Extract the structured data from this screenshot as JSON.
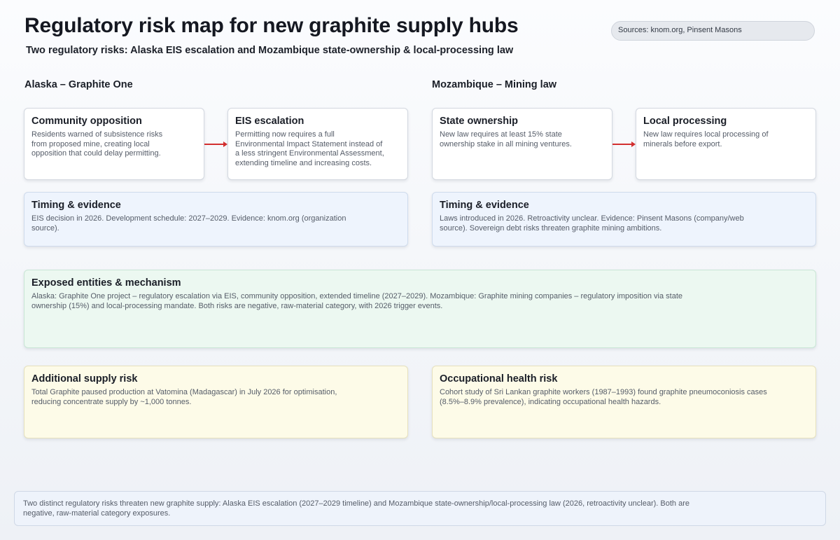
{
  "header": {
    "title": "Regulatory risk map for new graphite supply hubs",
    "subtitle": "Two regulatory risks: Alaska EIS escalation and Mozambique state-ownership & local-processing law",
    "sources": "Sources: knom.org, Pinsent Masons"
  },
  "alaska": {
    "section_title": "Alaska – Graphite One",
    "community": {
      "title": "Community opposition",
      "body": "Residents warned of subsistence risks from proposed mine, creating local opposition that could delay permitting."
    },
    "eis": {
      "title": "EIS escalation",
      "body": "Permitting now requires a full Environmental Impact Statement instead of a less stringent Environmental Assessment, extending timeline and increasing costs."
    },
    "timing": {
      "title": "Timing & evidence",
      "body": "EIS decision in 2026. Development schedule: 2027–2029. Evidence: knom.org (organization source)."
    }
  },
  "mozambique": {
    "section_title": "Mozambique – Mining law",
    "state": {
      "title": "State ownership",
      "body": "New law requires at least 15% state ownership stake in all mining ventures."
    },
    "local": {
      "title": "Local processing",
      "body": "New law requires local processing of minerals before export."
    },
    "timing": {
      "title": "Timing & evidence",
      "body": "Laws introduced in 2026. Retroactivity unclear. Evidence: Pinsent Masons (company/web source). Sovereign debt risks threaten graphite mining ambitions."
    }
  },
  "exposed": {
    "title": "Exposed entities & mechanism",
    "body": "Alaska: Graphite One project – regulatory escalation via EIS, community opposition, extended timeline (2027–2029). Mozambique: Graphite mining companies – regulatory imposition via state ownership (15%) and local-processing mandate. Both risks are negative, raw-material category, with 2026 trigger events."
  },
  "additional": {
    "title": "Additional supply risk",
    "body": "Total Graphite paused production at Vatomina (Madagascar) in July 2026 for optimisation, reducing concentrate supply by ~1,000 tonnes."
  },
  "occupational": {
    "title": "Occupational health risk",
    "body": "Cohort study of Sri Lankan graphite workers (1987–1993) found graphite pneumoconiosis cases (8.5%–8.9% prevalence), indicating occupational health hazards."
  },
  "footer": {
    "text": "Two distinct regulatory risks threaten new graphite supply: Alaska EIS escalation (2027–2029 timeline) and Mozambique state-ownership/local-processing law (2026, retroactivity unclear). Both are negative, raw-material category exposures."
  },
  "colors": {
    "arrow": "#d32f2f",
    "timing_bg": "#eef4fd",
    "exposed_bg": "#ecf8f1",
    "risk_bg": "#fdfbe8"
  }
}
